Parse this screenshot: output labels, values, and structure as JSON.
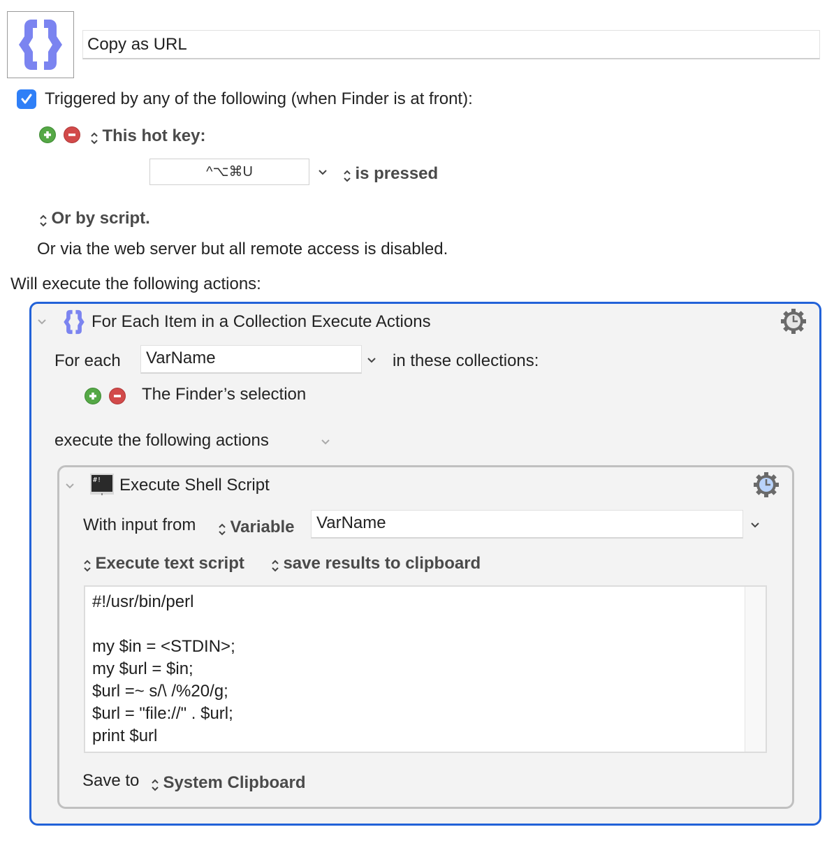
{
  "macro": {
    "icon": "curly-braces-icon",
    "name": "Copy as URL"
  },
  "trigger": {
    "enabled": true,
    "label": "Triggered by any of the following (when Finder is at front):",
    "hotkey_section_label": "This hot key:",
    "hotkey_value": "^⌥⌘U",
    "hotkey_condition": "is pressed",
    "script_label": "Or by script.",
    "web_server_note": "Or via the web server but all remote access is disabled."
  },
  "actions_heading": "Will execute the following actions:",
  "for_each_action": {
    "title": "For Each Item in a Collection Execute Actions",
    "icon": "curly-braces-icon",
    "settings_icon": "gear-clock-icon",
    "for_each_label": "For each",
    "variable_name": "VarName",
    "in_collections_label": "in these collections:",
    "collection_item": "The Finder’s selection",
    "execute_label": "execute the following actions"
  },
  "shell_action": {
    "title": "Execute Shell Script",
    "icon": "terminal-icon",
    "settings_icon": "gear-clock-icon",
    "input_label": "With input from",
    "input_source": "Variable",
    "input_variable": "VarName",
    "script_mode": "Execute text script",
    "result_mode": "save results to clipboard",
    "script_lines": [
      "#!/usr/bin/perl",
      "",
      "my $in = <STDIN>;",
      "my $url = $in;",
      "$url =~ s/\\ /%20/g;",
      "$url = \"file://\" . $url;",
      "print $url"
    ],
    "save_to_label": "Save to",
    "save_to_value": "System Clipboard"
  },
  "colors": {
    "accent_blue": "#2262d8",
    "checkbox_blue": "#2f7ff7",
    "icon_purple": "#7b84f0",
    "add_green": "#55a846",
    "remove_red": "#d24a4a"
  }
}
